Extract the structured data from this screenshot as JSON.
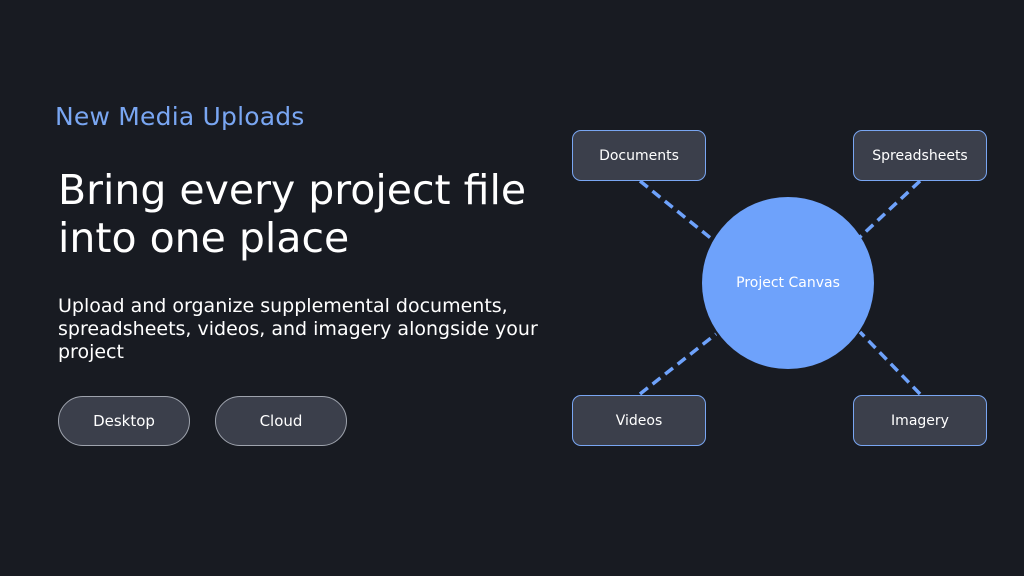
{
  "eyebrow": "New Media Uploads",
  "headline": "Bring every project file into one place",
  "subtext": "Upload and organize supplemental documents, spreadsheets, videos, and imagery alongside your project",
  "buttons": {
    "desktop": "Desktop",
    "cloud": "Cloud"
  },
  "diagram": {
    "hub": "Project Canvas",
    "nodes": {
      "documents": "Documents",
      "spreadsheets": "Spreadsheets",
      "videos": "Videos",
      "imagery": "Imagery"
    }
  },
  "colors": {
    "background": "#181b22",
    "accent": "#79a6f2",
    "hub": "#6ea2fb",
    "card": "#3b3f4b"
  }
}
